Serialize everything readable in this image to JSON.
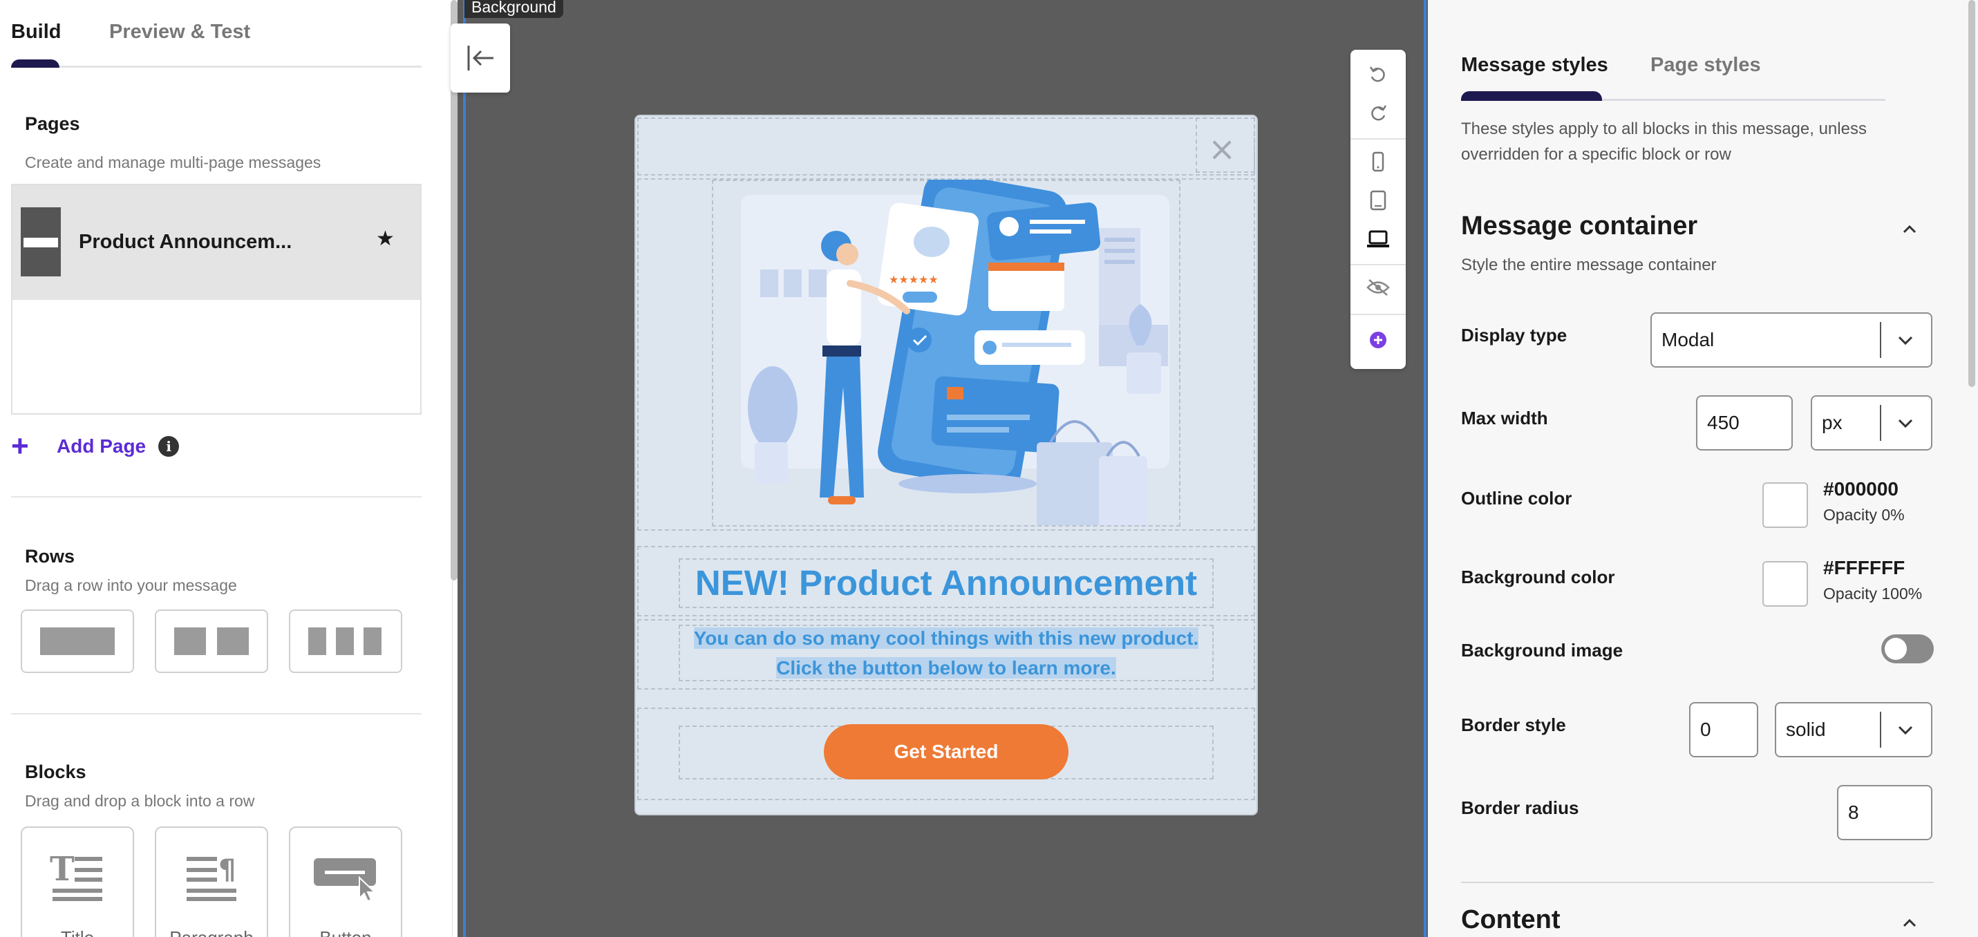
{
  "left_panel": {
    "tabs": {
      "build": "Build",
      "preview": "Preview & Test"
    },
    "pages": {
      "title": "Pages",
      "subtitle": "Create and manage multi-page messages",
      "items": [
        {
          "name": "Product Announcem..."
        }
      ],
      "add_label": "Add Page",
      "info_glyph": "i"
    },
    "rows": {
      "title": "Rows",
      "subtitle": "Drag a row into your message"
    },
    "blocks": {
      "title": "Blocks",
      "subtitle": "Drag and drop a block into a row",
      "items": [
        {
          "label": "Title"
        },
        {
          "label": "Paragraph"
        },
        {
          "label": "Button"
        }
      ]
    }
  },
  "canvas": {
    "background_label": "Background",
    "modal": {
      "headline": "NEW! Product Announcement",
      "body": "You can do so many cool things with this new product. Click the button below to learn more.",
      "cta": "Get Started",
      "close_glyph": "×"
    }
  },
  "right_panel": {
    "tabs": {
      "message_styles": "Message styles",
      "page_styles": "Page styles"
    },
    "intro": "These styles apply to all blocks in this message, unless overridden for a specific block or row",
    "message_container": {
      "title": "Message container",
      "subtitle": "Style the entire message container",
      "display_type": {
        "label": "Display type",
        "value": "Modal"
      },
      "max_width": {
        "label": "Max width",
        "value": "450",
        "unit": "px"
      },
      "outline_color": {
        "label": "Outline color",
        "hex": "#000000",
        "opacity": "Opacity 0%"
      },
      "background_color": {
        "label": "Background color",
        "hex": "#FFFFFF",
        "opacity": "Opacity 100%"
      },
      "background_image": {
        "label": "Background image",
        "enabled": false
      },
      "border_style": {
        "label": "Border style",
        "width": "0",
        "style": "solid"
      },
      "border_radius": {
        "label": "Border radius",
        "value": "8"
      }
    },
    "content": {
      "title": "Content"
    }
  },
  "colors": {
    "brand_purple": "#5b2bd6",
    "tab_indicator": "#1e1a4f",
    "canvas_bg": "#5c5c5c",
    "modal_bg": "#dde6ef",
    "headline_blue": "#3b95da",
    "cta_orange": "#ee7a36"
  }
}
